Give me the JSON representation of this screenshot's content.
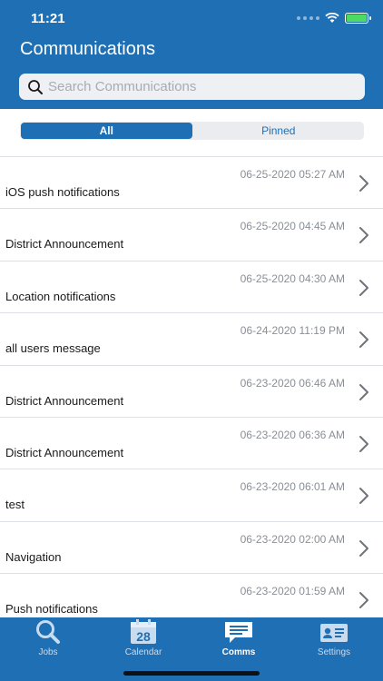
{
  "status_bar": {
    "time": "11:21"
  },
  "header": {
    "title": "Communications"
  },
  "search": {
    "placeholder": "Search Communications"
  },
  "segments": {
    "all": "All",
    "pinned": "Pinned",
    "selected": "All"
  },
  "messages": [
    {
      "date": "06-25-2020 05:27 AM",
      "title": "iOS push notifications"
    },
    {
      "date": "06-25-2020 04:45 AM",
      "title": "District Announcement"
    },
    {
      "date": "06-25-2020 04:30 AM",
      "title": "Location notifications"
    },
    {
      "date": "06-24-2020 11:19 PM",
      "title": "all users message"
    },
    {
      "date": "06-23-2020 06:46 AM",
      "title": "District Announcement"
    },
    {
      "date": "06-23-2020 06:36 AM",
      "title": "District Announcement"
    },
    {
      "date": "06-23-2020 06:01 AM",
      "title": "test"
    },
    {
      "date": "06-23-2020 02:00 AM",
      "title": "Navigation"
    },
    {
      "date": "06-23-2020 01:59 AM",
      "title": "Push notifications"
    }
  ],
  "tabbar": {
    "jobs": "Jobs",
    "calendar": "Calendar",
    "calendar_day": "28",
    "comms": "Comms",
    "settings": "Settings",
    "active": "Comms"
  },
  "colors": {
    "brand": "#1f6fb5",
    "divider": "#dcdfe3",
    "battery": "#4cd964"
  }
}
